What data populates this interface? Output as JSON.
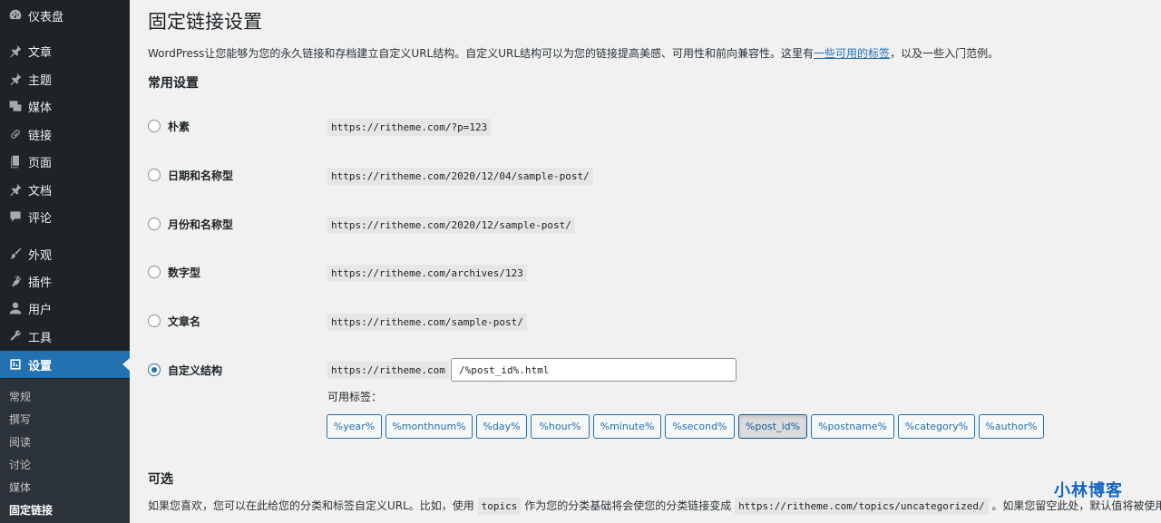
{
  "sidebar": {
    "items": [
      {
        "label": "仪表盘",
        "icon": "dashboard-icon"
      },
      {
        "label": "文章",
        "icon": "pin-icon"
      },
      {
        "label": "主题",
        "icon": "pin-icon"
      },
      {
        "label": "媒体",
        "icon": "media-icon"
      },
      {
        "label": "链接",
        "icon": "link-icon"
      },
      {
        "label": "页面",
        "icon": "page-icon"
      },
      {
        "label": "文档",
        "icon": "pin-icon"
      },
      {
        "label": "评论",
        "icon": "comment-icon"
      },
      {
        "label": "外观",
        "icon": "brush-icon"
      },
      {
        "label": "插件",
        "icon": "plugin-icon"
      },
      {
        "label": "用户",
        "icon": "user-icon"
      },
      {
        "label": "工具",
        "icon": "wrench-icon"
      },
      {
        "label": "设置",
        "icon": "settings-icon"
      }
    ],
    "submenu": [
      "常规",
      "撰写",
      "阅读",
      "讨论",
      "媒体",
      "固定链接"
    ]
  },
  "page": {
    "title": "固定链接设置",
    "intro_before": "WordPress让您能够为您的永久链接和存档建立自定义URL结构。自定义URL结构可以为您的链接提高美感、可用性和前向兼容性。这里有",
    "intro_link": "一些可用的标签",
    "intro_after": "，以及一些入门范例。",
    "common_settings_title": "常用设置",
    "options": [
      {
        "label": "朴素",
        "example": "https://ritheme.com/?p=123",
        "checked": false
      },
      {
        "label": "日期和名称型",
        "example": "https://ritheme.com/2020/12/04/sample-post/",
        "checked": false
      },
      {
        "label": "月份和名称型",
        "example": "https://ritheme.com/2020/12/sample-post/",
        "checked": false
      },
      {
        "label": "数字型",
        "example": "https://ritheme.com/archives/123",
        "checked": false
      },
      {
        "label": "文章名",
        "example": "https://ritheme.com/sample-post/",
        "checked": false
      },
      {
        "label": "自定义结构",
        "example": "https://ritheme.com",
        "checked": true
      }
    ],
    "custom_structure_value": "/%post_id%.html",
    "available_tags_label": "可用标签：",
    "tags": [
      "%year%",
      "%monthnum%",
      "%day%",
      "%hour%",
      "%minute%",
      "%second%",
      "%post_id%",
      "%postname%",
      "%category%",
      "%author%"
    ],
    "pressed_tag": "%post_id%",
    "optional_title": "可选",
    "optional_desc_1": "如果您喜欢，您可以在此给您的分类和标签自定义URL。比如，使用",
    "optional_code_1": "topics",
    "optional_desc_2": "作为您的分类基础将会使您的分类链接变成",
    "optional_code_2": "https://ritheme.com/topics/uncategorized/",
    "optional_desc_3": "。如果您留空此处，默认值将被使用。"
  },
  "watermark": "小林博客",
  "colors": {
    "sidebar_bg": "#1d2327",
    "accent": "#2271b1",
    "submenu_bg": "#2c3338",
    "page_bg": "#f1f1f1"
  }
}
